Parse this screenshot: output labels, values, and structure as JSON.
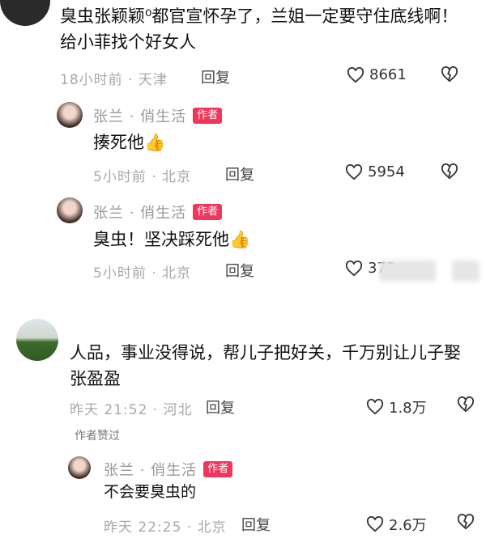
{
  "comment1": {
    "text": "臭虫张颖颖⁰都官宣怀孕了，兰姐一定要守住底线啊！给小菲找个好女人",
    "time": "18小时前 · 天津",
    "reply_label": "回复",
    "likes": "8661"
  },
  "reply1": {
    "author": "张兰 · 俏生活",
    "badge": "作者",
    "text": "揍死他👍",
    "time": "5小时前 · 北京",
    "reply_label": "回复",
    "likes": "5954"
  },
  "reply2": {
    "author": "张兰 · 俏生活",
    "badge": "作者",
    "text": "臭虫！坚决踩死他👍",
    "time": "5小时前 · 北京",
    "reply_label": "回复",
    "likes": "372"
  },
  "comment2": {
    "text": "人品，事业没得说，帮儿子把好关，千万别让儿子娶张盈盈",
    "time": "昨天 21:52 · 河北",
    "reply_label": "回复",
    "likes": "1.8万",
    "author_liked": "作者赞过"
  },
  "reply3": {
    "author": "张兰 · 俏生活",
    "badge": "作者",
    "text": "不会要臭虫的",
    "time": "昨天 22:25 · 北京",
    "reply_label": "回复",
    "likes": "2.6万"
  },
  "colors": {
    "badge": "#f0365a",
    "meta": "#a8a8a8"
  }
}
